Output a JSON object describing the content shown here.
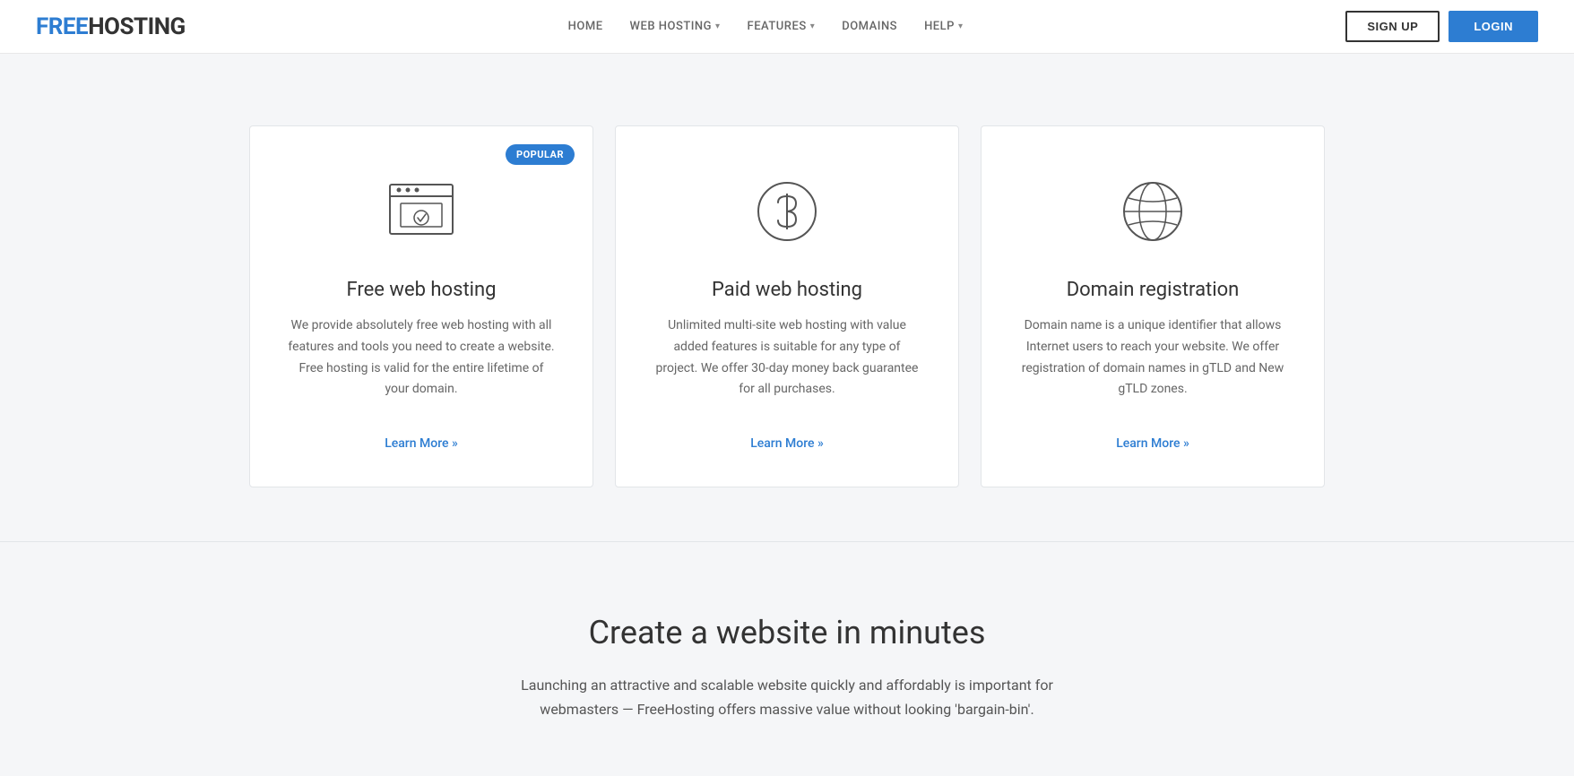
{
  "header": {
    "logo_free": "FREE",
    "logo_hosting": "HOSTING",
    "nav": [
      {
        "label": "HOME",
        "dropdown": false
      },
      {
        "label": "WEB HOSTING",
        "dropdown": true
      },
      {
        "label": "FEATURES",
        "dropdown": true
      },
      {
        "label": "DOMAINS",
        "dropdown": false
      },
      {
        "label": "HELP",
        "dropdown": true
      }
    ],
    "signup_label": "SIGN UP",
    "login_label": "LOGIN"
  },
  "cards": [
    {
      "id": "free-hosting",
      "title": "Free web hosting",
      "description": "We provide absolutely free web hosting with all features and tools you need to create a website. Free hosting is valid for the entire lifetime of your domain.",
      "learn_more": "Learn More »",
      "popular": true,
      "popular_label": "POPULAR",
      "icon": "browser"
    },
    {
      "id": "paid-hosting",
      "title": "Paid web hosting",
      "description": "Unlimited multi-site web hosting with value added features is suitable for any type of project. We offer 30-day money back guarantee for all purchases.",
      "learn_more": "Learn More »",
      "popular": false,
      "icon": "dollar"
    },
    {
      "id": "domain-registration",
      "title": "Domain registration",
      "description": "Domain name is a unique identifier that allows Internet users to reach your website. We offer registration of domain names in gTLD and New gTLD zones.",
      "learn_more": "Learn More »",
      "popular": false,
      "icon": "globe"
    }
  ],
  "bottom": {
    "title": "Create a website in minutes",
    "description": "Launching an attractive and scalable website quickly and affordably is important for webmasters — FreeHosting offers massive value without looking 'bargain-bin'."
  }
}
